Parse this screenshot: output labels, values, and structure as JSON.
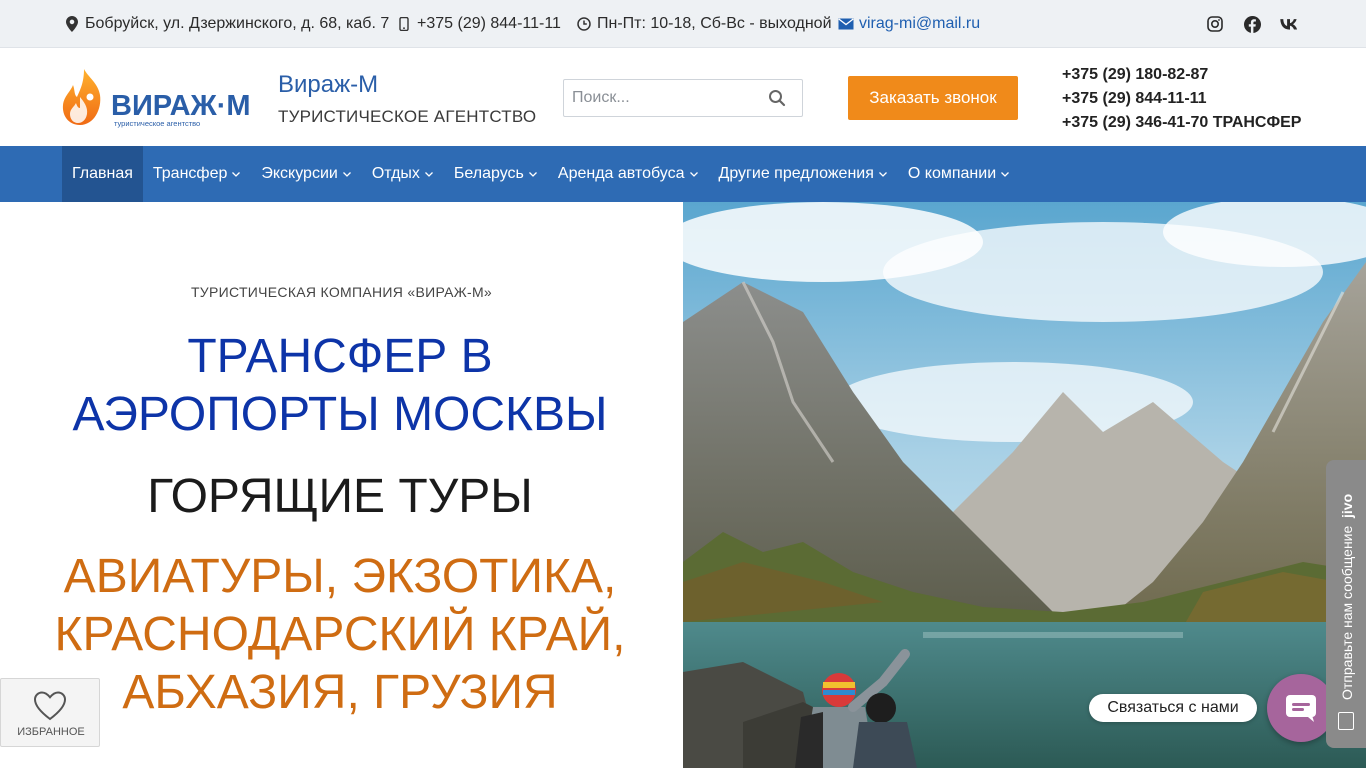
{
  "topbar": {
    "address": "Бобруйск, ул. Дзержинского, д. 68, каб. 7",
    "phone": "+375 (29) 844-11-11",
    "hours": "Пн-Пт: 10-18, Сб-Вс - выходной",
    "email": "virag-mi@mail.ru",
    "icons": {
      "address": "map-pin-icon",
      "phone": "mobile-phone-icon",
      "hours": "clock-icon",
      "email": "envelope-icon"
    },
    "socials": [
      "instagram-icon",
      "facebook-icon",
      "vk-icon"
    ]
  },
  "header": {
    "logo_text": "ВИРАЖ·М",
    "logo_tagline": "туристическое агентство",
    "brand_name": "Вираж-М",
    "brand_sub": "ТУРИСТИЧЕСКОЕ АГЕНТСТВО",
    "search_placeholder": "Поиск...",
    "call_button": "Заказать звонок",
    "phones": [
      "+375 (29) 180-82-87",
      "+375 (29) 844-11-11",
      "+375 (29) 346-41-70 ТРАНСФЕР"
    ]
  },
  "nav": {
    "items": [
      {
        "label": "Главная",
        "active": true,
        "dropdown": false
      },
      {
        "label": "Трансфер",
        "active": false,
        "dropdown": true
      },
      {
        "label": "Экскурсии",
        "active": false,
        "dropdown": true
      },
      {
        "label": "Отдых",
        "active": false,
        "dropdown": true
      },
      {
        "label": "Беларусь",
        "active": false,
        "dropdown": true
      },
      {
        "label": "Аренда автобуса",
        "active": false,
        "dropdown": true
      },
      {
        "label": "Другие предложения",
        "active": false,
        "dropdown": true
      },
      {
        "label": "О компании",
        "active": false,
        "dropdown": true
      }
    ]
  },
  "hero": {
    "eyebrow": "ТУРИСТИЧЕСКАЯ КОМПАНИЯ «ВИРАЖ-М»",
    "headline_blue": "ТРАНСФЕР В АЭРОПОРТЫ МОСКВЫ",
    "headline_dark": "ГОРЯЩИЕ ТУРЫ",
    "headline_orange": "АВИАТУРЫ, ЭКЗОТИКА, КРАСНОДАРСКИЙ КРАЙ, АБХАЗИЯ, ГРУЗИЯ"
  },
  "favorites": {
    "label": "ИЗБРАННОЕ"
  },
  "chat": {
    "contact_label": "Связаться с нами",
    "jivo_text": "Отправьте нам сообщение",
    "jivo_brand": "jivo"
  },
  "colors": {
    "nav_bg": "#2e6bb4",
    "accent_orange": "#f08a1a",
    "headline_blue": "#0d34a8",
    "headline_orange": "#cf6c12"
  }
}
